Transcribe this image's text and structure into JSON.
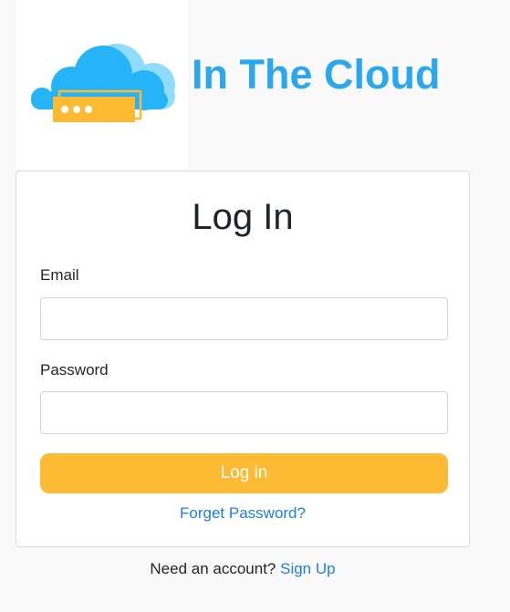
{
  "brand": {
    "title": "In The Cloud",
    "logo_icon": "cloud-server-icon",
    "colors": {
      "title": "#2ba7f0",
      "cloud_light": "#8fdcff",
      "cloud": "#27b4f6",
      "server": "#fcbb32"
    }
  },
  "login": {
    "heading": "Log In",
    "email_label": "Email",
    "email_value": "",
    "password_label": "Password",
    "password_value": "",
    "submit_label": "Log in",
    "forgot_link": "Forget Password?"
  },
  "signup": {
    "prompt": "Need an account?",
    "link": "Sign Up"
  },
  "colors": {
    "button": "#fcbb32",
    "link": "#1f7ee3",
    "background": "#f9f9f9"
  }
}
